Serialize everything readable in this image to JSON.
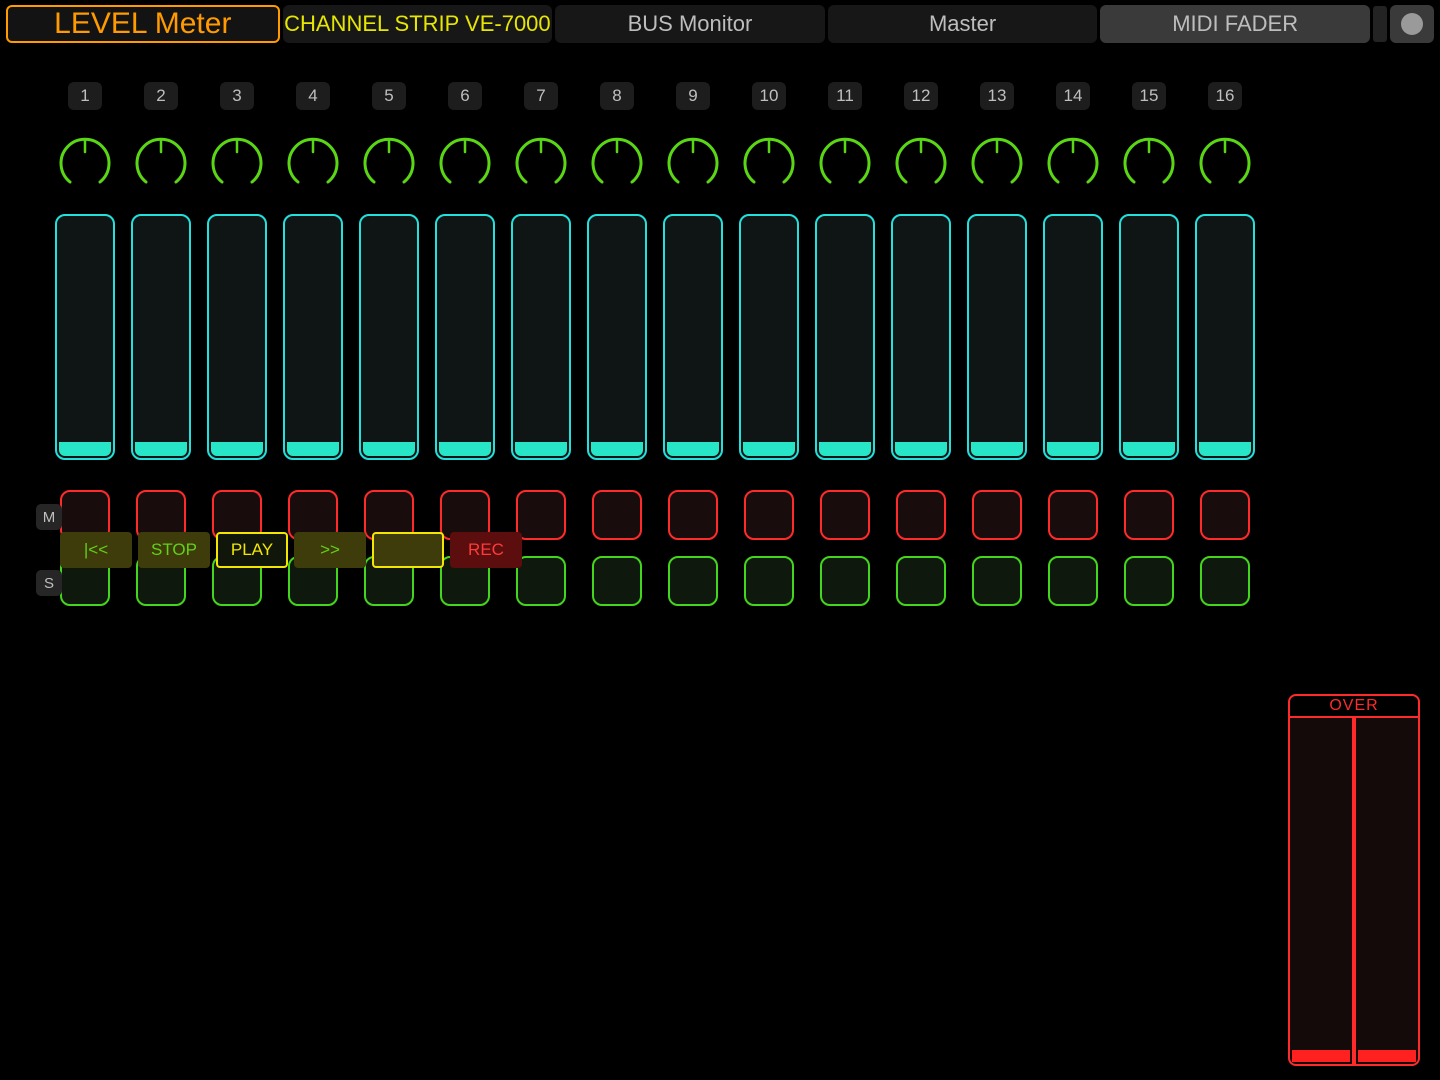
{
  "tabs": {
    "level_meter": "LEVEL Meter",
    "channel_strip": "CHANNEL STRIP VE-7000",
    "bus_monitor": "BUS Monitor",
    "master": "Master",
    "midi_fader": "MIDI FADER"
  },
  "channels": [
    "1",
    "2",
    "3",
    "4",
    "5",
    "6",
    "7",
    "8",
    "9",
    "10",
    "11",
    "12",
    "13",
    "14",
    "15",
    "16"
  ],
  "side_labels": {
    "mute": "M",
    "solo": "S"
  },
  "over": {
    "label": "OVER"
  },
  "transport": {
    "rewind": "|<<",
    "stop": "STOP",
    "play": "PLAY",
    "ffwd": ">>",
    "blank": "",
    "rec": "REC"
  },
  "colors": {
    "accent_orange": "#ff9a00",
    "accent_yellow": "#e6e600",
    "knob_green": "#59d615",
    "meter_cyan": "#24e0dc",
    "meter_fill": "#27e6c7",
    "mute_red": "#ff2b2b",
    "solo_green": "#44d61c",
    "rec_red": "#ff3a3a"
  }
}
